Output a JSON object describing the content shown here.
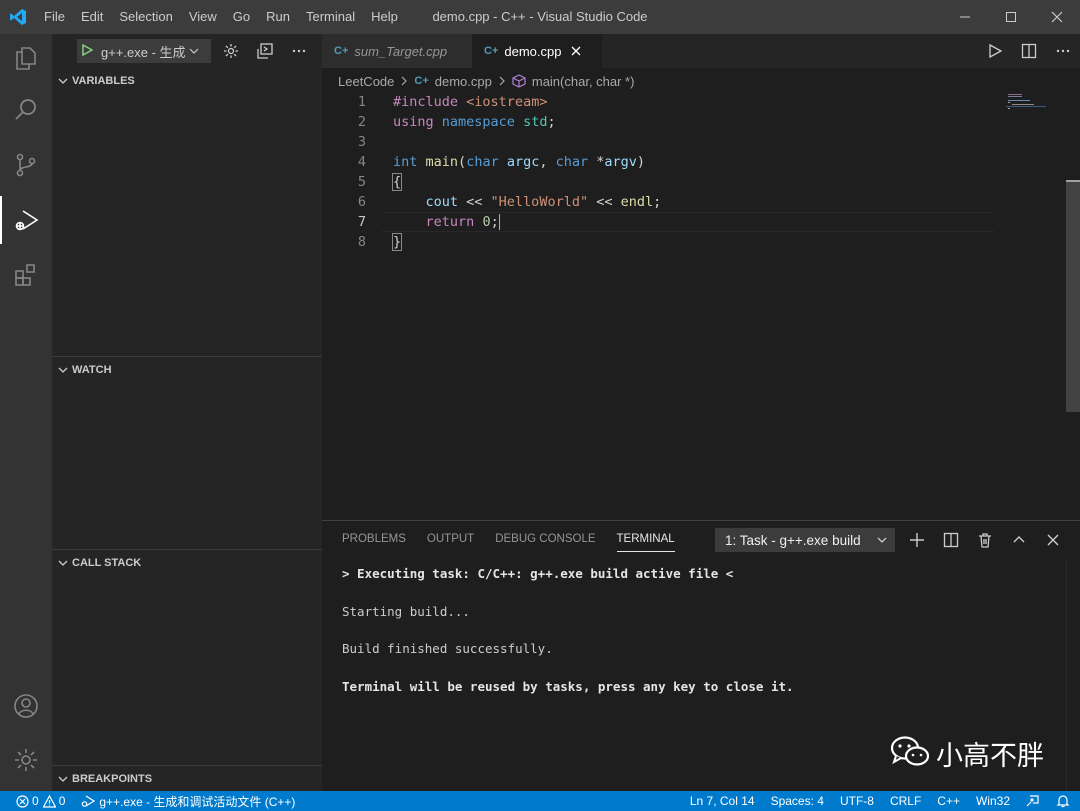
{
  "titlebar": {
    "menu": [
      "File",
      "Edit",
      "Selection",
      "View",
      "Go",
      "Run",
      "Terminal",
      "Help"
    ],
    "title": "demo.cpp - C++ - Visual Studio Code"
  },
  "activitybar": {
    "items": [
      "files-icon",
      "search-icon",
      "source-control-icon",
      "run-debug-icon",
      "extensions-icon"
    ],
    "bottom": [
      "account-icon",
      "settings-gear-icon"
    ],
    "active": "run-debug-icon"
  },
  "sidebar": {
    "debug_config": "g++.exe - 生成",
    "sections": {
      "variables": "VARIABLES",
      "watch": "WATCH",
      "call_stack": "CALL STACK",
      "breakpoints": "BREAKPOINTS"
    }
  },
  "editor": {
    "tabs": [
      {
        "label": "sum_Target.cpp",
        "active": false
      },
      {
        "label": "demo.cpp",
        "active": true
      }
    ],
    "file_icon_label": "C+",
    "breadcrumb": [
      "LeetCode",
      "demo.cpp",
      "main(char, char *)"
    ],
    "code": [
      {
        "n": "1",
        "text": "#include <iostream>"
      },
      {
        "n": "2",
        "text": "using namespace std;"
      },
      {
        "n": "3",
        "text": ""
      },
      {
        "n": "4",
        "text": "int main(char argc, char *argv)"
      },
      {
        "n": "5",
        "text": "{"
      },
      {
        "n": "6",
        "text": "    cout << \"HelloWorld\" << endl;"
      },
      {
        "n": "7",
        "text": "    return 0;"
      },
      {
        "n": "8",
        "text": "}"
      }
    ],
    "cursor_line": 7
  },
  "panel": {
    "tabs": [
      "PROBLEMS",
      "OUTPUT",
      "DEBUG CONSOLE",
      "TERMINAL"
    ],
    "active_tab": "TERMINAL",
    "terminal_select": "1: Task - g++.exe build",
    "terminal_output": [
      {
        "text": "> Executing task: C/C++: g++.exe build active file <",
        "bold": true
      },
      {
        "text": "Starting build...",
        "bold": false
      },
      {
        "text": "Build finished successfully.",
        "bold": false
      },
      {
        "text": "Terminal will be reused by tasks, press any key to close it.",
        "bold": true
      }
    ],
    "watermark": "小高不胖"
  },
  "statusbar": {
    "errors": "0",
    "warnings": "0",
    "debug_target": "g++.exe - 生成和调试活动文件 (C++)",
    "position": "Ln 7, Col 14",
    "spaces": "Spaces: 4",
    "encoding": "UTF-8",
    "eol": "CRLF",
    "language": "C++",
    "platform": "Win32"
  },
  "colors": {
    "accent": "#007acc",
    "titlebar": "#3c3c3c",
    "activitybar": "#333333",
    "sidebar": "#252526",
    "editor": "#1e1e1e"
  }
}
